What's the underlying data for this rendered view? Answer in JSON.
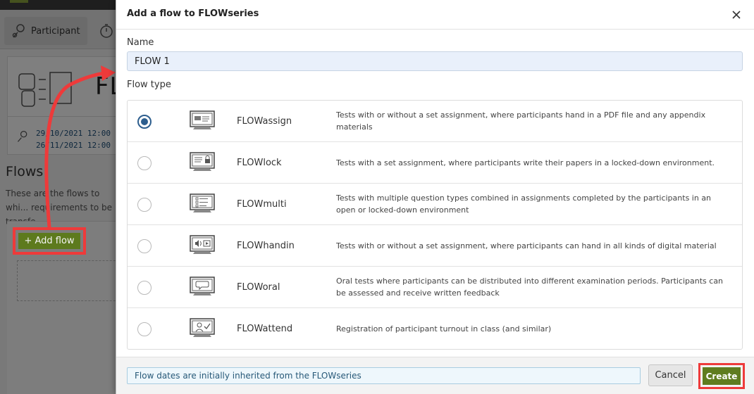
{
  "background": {
    "tabs": [
      {
        "label": "Participant"
      }
    ],
    "fl_text": "FL",
    "dates": [
      "29/10/2021 12:00",
      "26/11/2021 12:00"
    ],
    "section_title": "Flows",
    "section_desc": "These are the flows to whi... requirements to be transfe...",
    "add_flow_label": "+ Add flow"
  },
  "modal": {
    "title": "Add a flow to FLOWseries",
    "name_label": "Name",
    "name_value": "FLOW 1",
    "flow_type_label": "Flow type",
    "flow_types": [
      {
        "name": "FLOWassign",
        "icon": "assign-icon",
        "selected": true,
        "description": "Tests with or without a set assignment, where participants hand in a PDF file and any appendix materials"
      },
      {
        "name": "FLOWlock",
        "icon": "lock-icon",
        "selected": false,
        "description": "Tests with a set assignment, where participants write their papers in a locked-down environment."
      },
      {
        "name": "FLOWmulti",
        "icon": "multi-icon",
        "selected": false,
        "description": "Tests with multiple question types combined in assignments completed by the participants in an open or locked-down environment"
      },
      {
        "name": "FLOWhandin",
        "icon": "handin-icon",
        "selected": false,
        "description": "Tests with or without a set assignment, where participants can hand in all kinds of digital material"
      },
      {
        "name": "FLOWoral",
        "icon": "oral-icon",
        "selected": false,
        "description": "Oral tests where participants can be distributed into different examination periods. Participants can be assessed and receive written feedback"
      },
      {
        "name": "FLOWattend",
        "icon": "attend-icon",
        "selected": false,
        "description": "Registration of participant turnout in class (and similar)"
      }
    ],
    "info_text": "Flow dates are initially inherited from the FLOWseries",
    "cancel_label": "Cancel",
    "create_label": "Create"
  },
  "colors": {
    "primary_green": "#5f7c1f",
    "highlight_red": "#ee3a3a",
    "radio_blue": "#2d5e8e",
    "info_bg": "#eef7fc"
  }
}
